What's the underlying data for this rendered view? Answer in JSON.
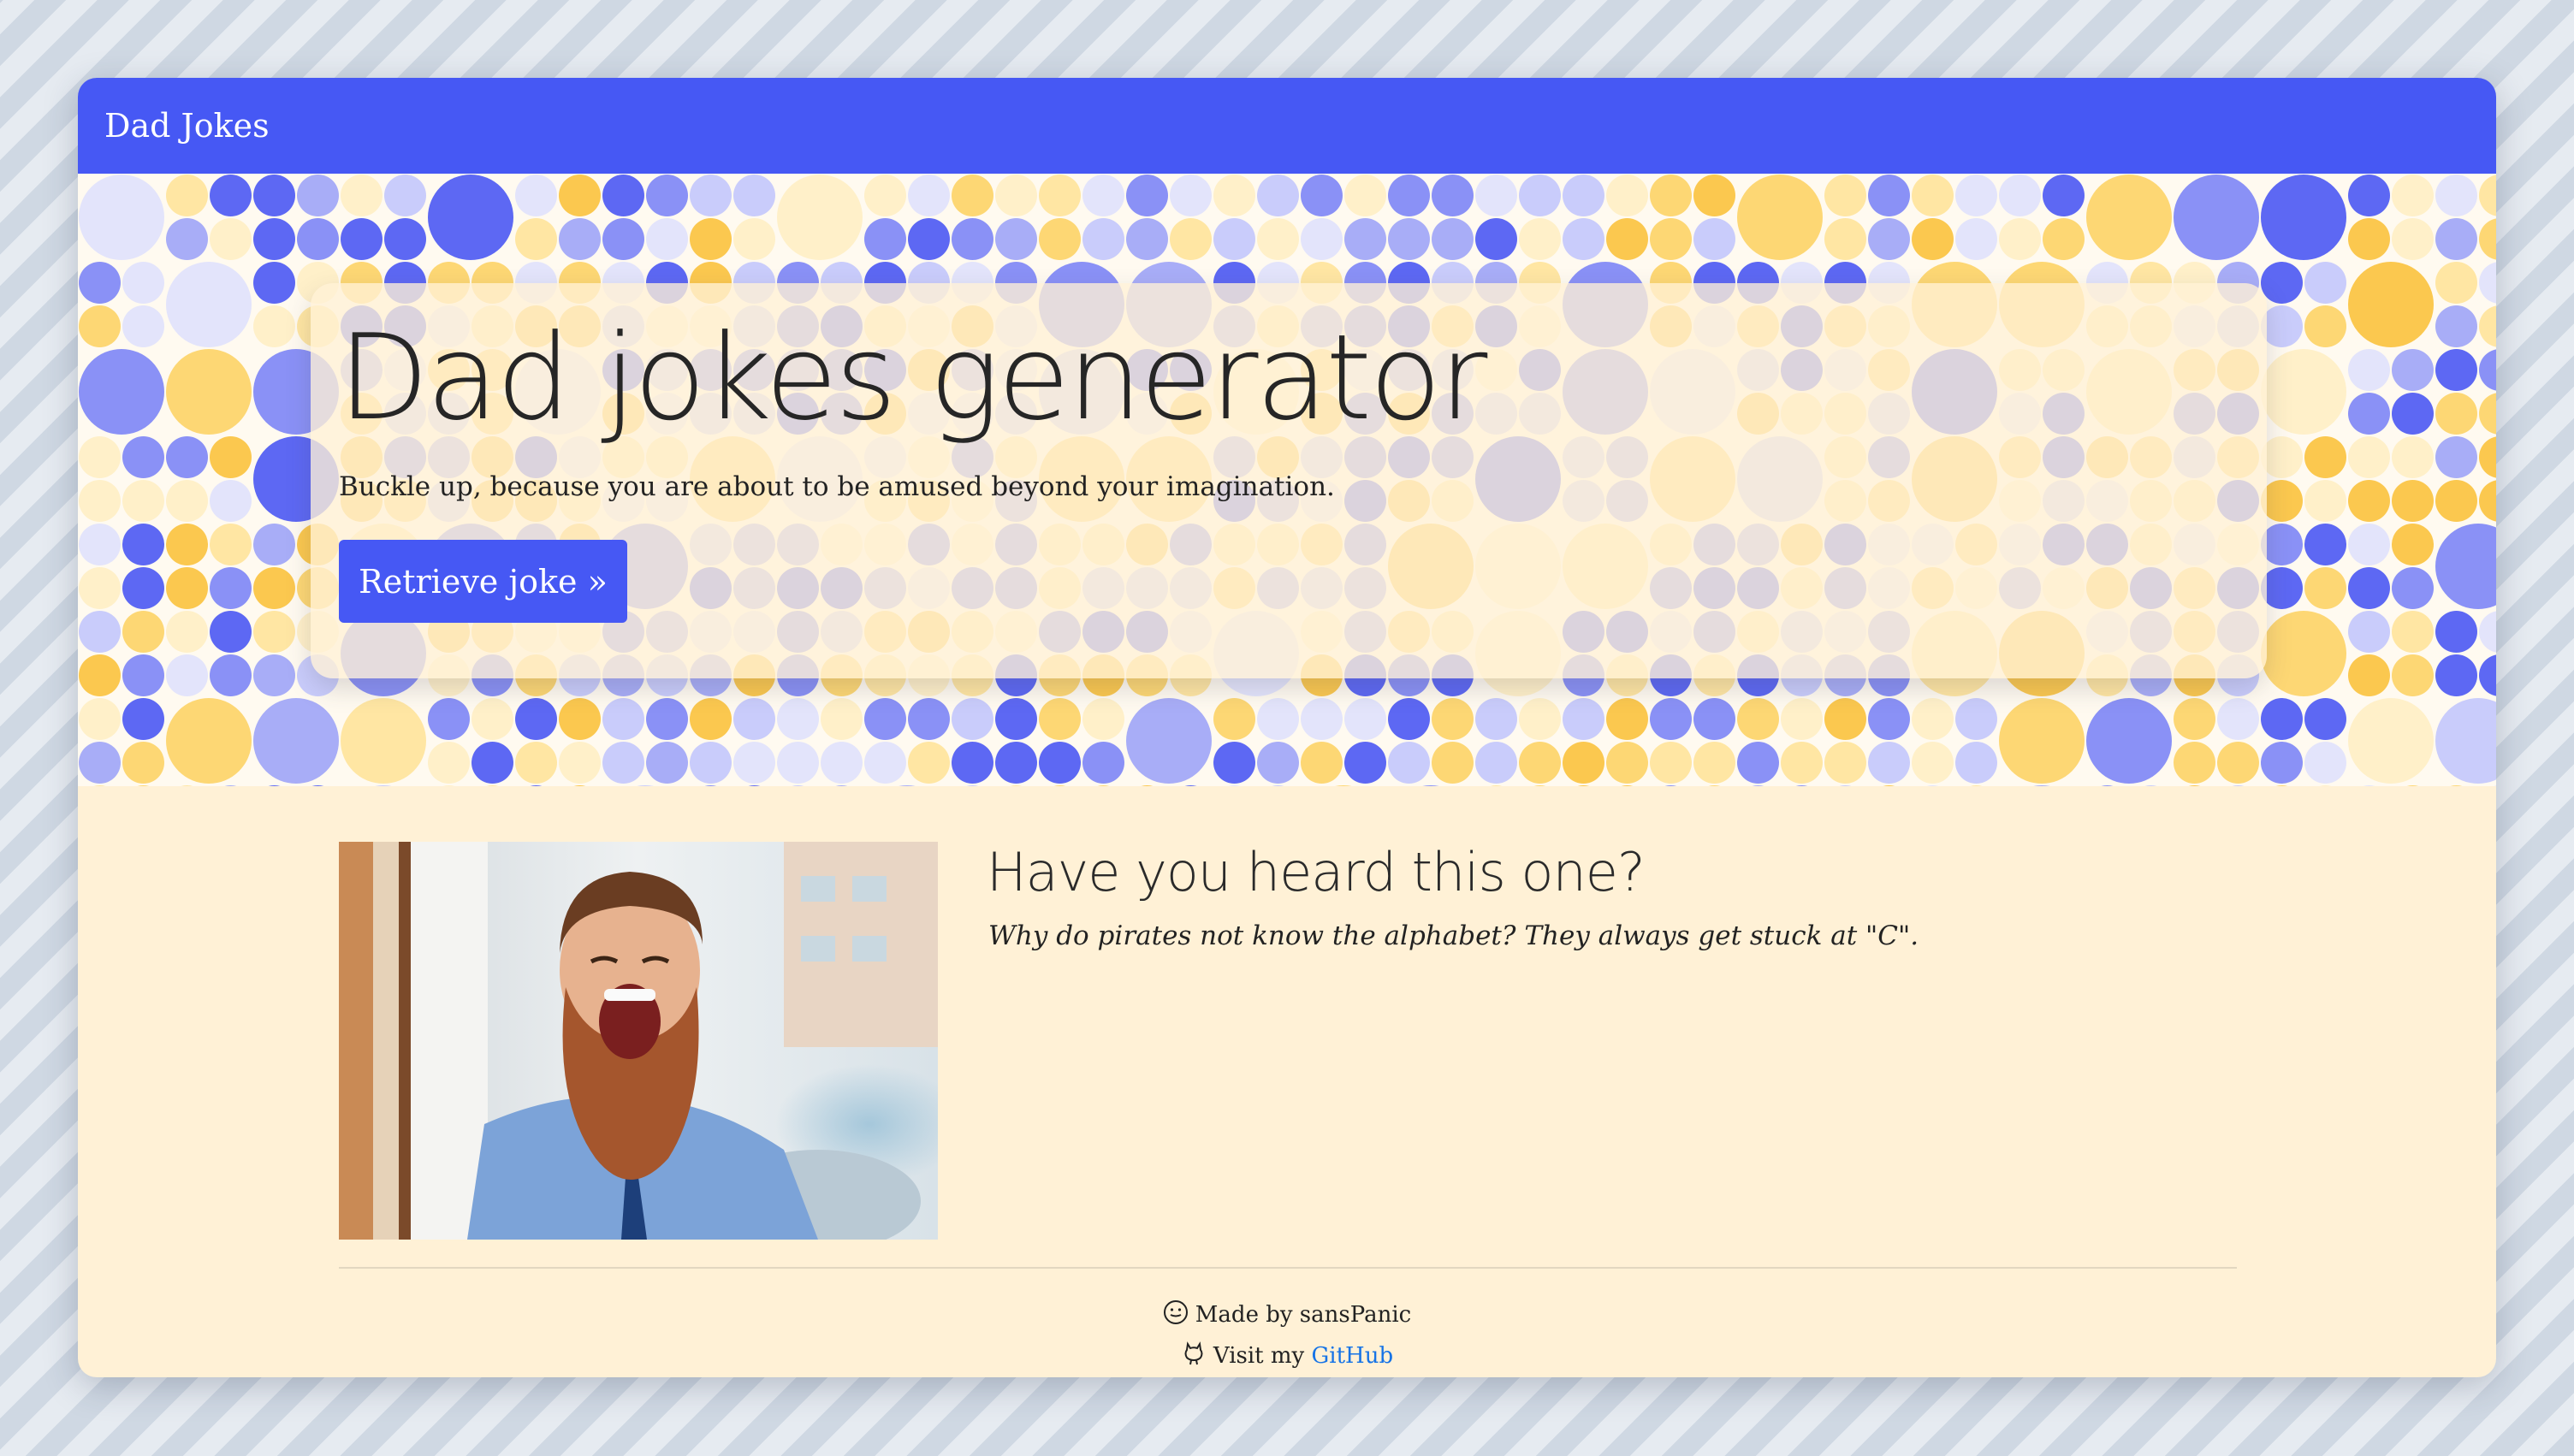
{
  "navbar": {
    "brand": "Dad Jokes"
  },
  "hero": {
    "title": "Dad jokes generator",
    "subtitle": "Buckle up, because you are about to be amused beyond your imagination.",
    "button_label": "Retrieve joke »"
  },
  "joke": {
    "heading": "Have you heard this one?",
    "text": "Why do pirates not know the alphabet? They always get stuck at \"C\"."
  },
  "footer": {
    "made_by": "Made by sansPanic",
    "visit_prefix": "Visit my",
    "github_label": "GitHub"
  },
  "icons": {
    "made_by_icon": "smiley-face-icon",
    "visit_icon": "github-octocat-icon"
  },
  "colors": {
    "primary": "#4658f4",
    "background_cream": "#fff1d6",
    "link": "#1673e6"
  }
}
